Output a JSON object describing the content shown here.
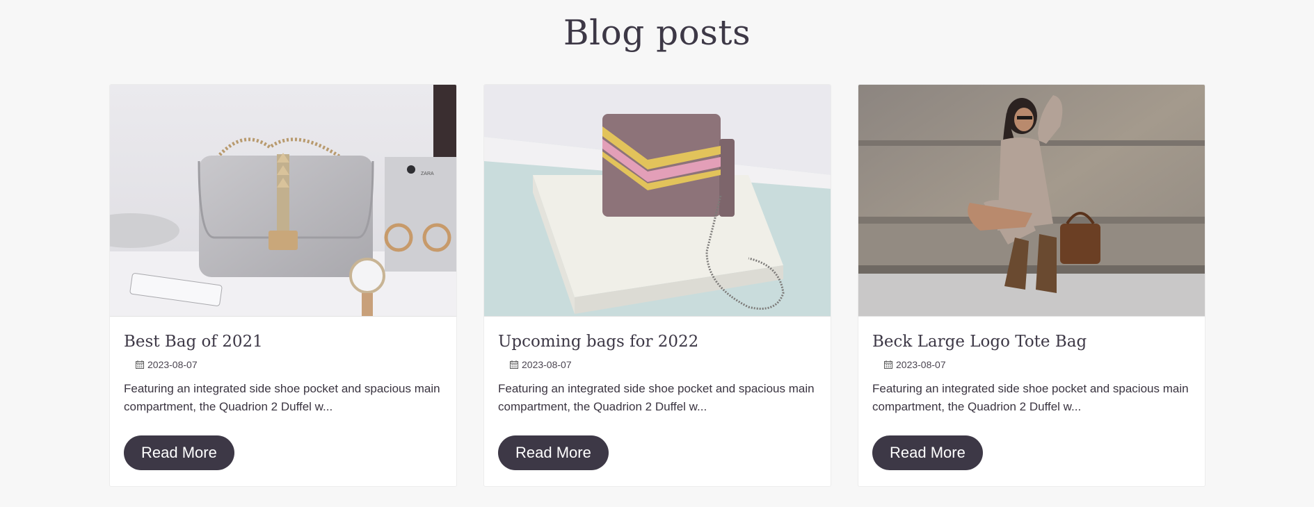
{
  "page": {
    "title": "Blog posts"
  },
  "posts": [
    {
      "title": "Best Bag of 2021",
      "date": "2023-08-07",
      "excerpt": "Featuring an integrated side shoe pocket and spacious main compartment, the Quadrion 2 Duffel w...",
      "button_label": "Read More",
      "image_subject": "grey-handbag-with-jewelry"
    },
    {
      "title": "Upcoming bags for 2022",
      "date": "2023-08-07",
      "excerpt": "Featuring an integrated side shoe pocket and spacious main compartment, the Quadrion 2 Duffel w...",
      "button_label": "Read More",
      "image_subject": "mauve-crossbody-bag-on-pedestal"
    },
    {
      "title": "Beck Large Logo Tote Bag",
      "date": "2023-08-07",
      "excerpt": "Featuring an integrated side shoe pocket and spacious main compartment, the Quadrion 2 Duffel w...",
      "button_label": "Read More",
      "image_subject": "woman-with-brown-tote-on-steps"
    }
  ],
  "colors": {
    "background": "#f7f7f7",
    "card": "#ffffff",
    "heading": "#3d3846",
    "button": "#3d3846",
    "button_text": "#ffffff"
  },
  "icons": {
    "date": "calendar-icon"
  }
}
